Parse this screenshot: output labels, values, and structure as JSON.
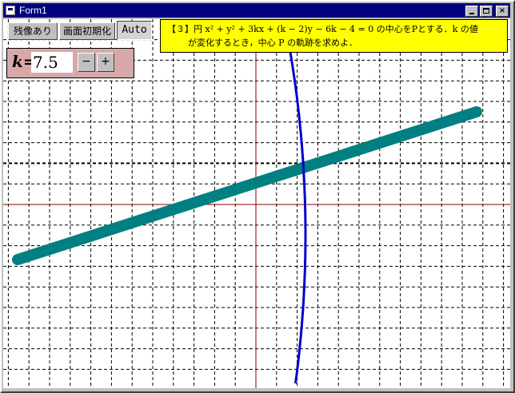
{
  "window": {
    "title": "Form1"
  },
  "titlebar_icons": [
    "minimize-icon",
    "maximize-icon",
    "close-icon"
  ],
  "toolbar": {
    "trace_label": "残像あり",
    "reset_label": "画面初期化",
    "auto_label": "Auto"
  },
  "problem": {
    "line1": "【３】円 x² + y² + 3kx + (k − 2)y − 6k − 4 = 0 の中心をPとする．k の値",
    "line2": "が変化するとき，中心 P の軌跡を求めよ．"
  },
  "control": {
    "k_label": "k=",
    "k_value": "7.5",
    "minus_label": "−",
    "plus_label": "+"
  },
  "colors": {
    "grid": "#000000",
    "axis": "#8b0000",
    "circle": "#0000cc",
    "locus": "#008080",
    "problem_bg": "#ffff00",
    "control_bg": "#d7a8a8"
  }
}
